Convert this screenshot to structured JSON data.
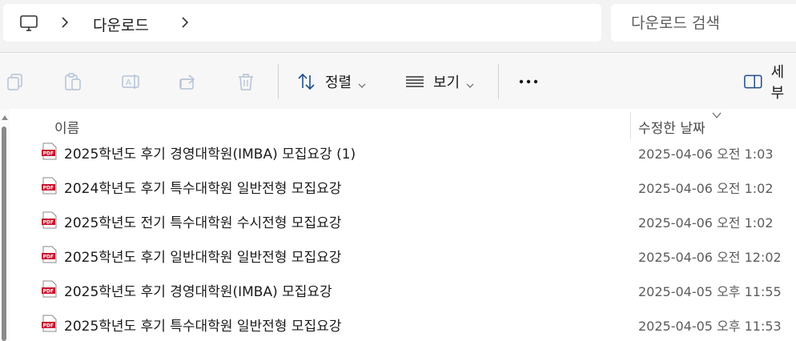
{
  "address": {
    "location": "다운로드"
  },
  "search": {
    "placeholder": "다운로드 검색"
  },
  "toolbar": {
    "sort_label": "정렬",
    "view_label": "보기",
    "details_label": "세부"
  },
  "columns": {
    "name": "이름",
    "date": "수정한 날짜"
  },
  "files": [
    {
      "name": "2025학년도 후기 경영대학원(IMBA) 모집요강 (1)",
      "date": "2025-04-06 오전 1:03"
    },
    {
      "name": "2024학년도 후기 특수대학원 일반전형 모집요강",
      "date": "2025-04-06 오전 1:02"
    },
    {
      "name": "2025학년도 전기 특수대학원 수시전형 모집요강",
      "date": "2025-04-06 오전 1:02"
    },
    {
      "name": "2025학년도 후기 일반대학원 일반전형 모집요강",
      "date": "2025-04-06 오전 12:02"
    },
    {
      "name": "2025학년도 후기 경영대학원(IMBA) 모집요강",
      "date": "2025-04-05 오후 11:55"
    },
    {
      "name": "2025학년도 후기 특수대학원 일반전형 모집요강",
      "date": "2025-04-05 오후 11:53"
    }
  ]
}
